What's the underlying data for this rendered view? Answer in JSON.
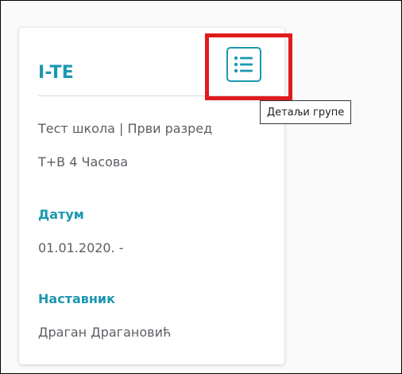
{
  "group_card": {
    "title": "I-TE",
    "school_line": "Тест школа | Први разред",
    "hours_line": "Т+В 4 Часова",
    "date_label": "Датум",
    "date_value": "01.01.2020. -",
    "teacher_label": "Наставник",
    "teacher_value": "Драган Драгановић",
    "details_icon": "list-icon"
  },
  "tooltip": {
    "text": "Детаљи групе"
  },
  "colors": {
    "accent": "#1b98b0",
    "highlight": "#e01b1b",
    "text_muted": "#5b5f64"
  }
}
